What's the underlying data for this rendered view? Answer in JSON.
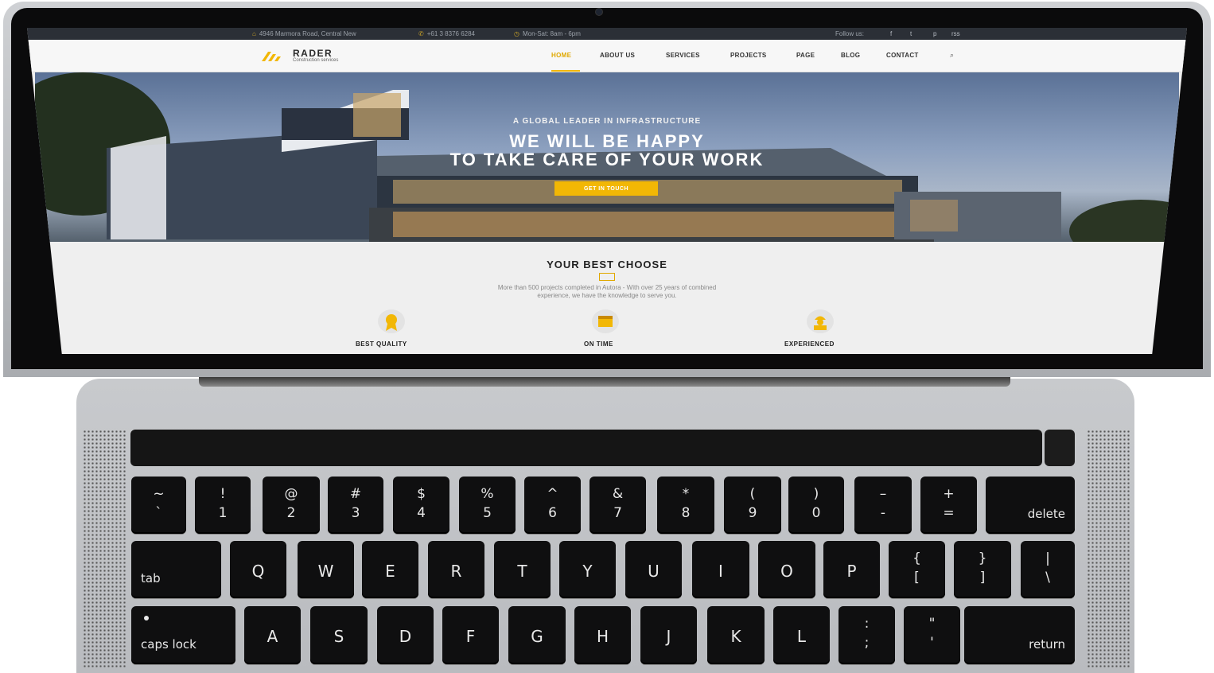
{
  "topbar": {
    "address": "4946 Marmora Road, Central New",
    "phone": "+61 3 8376 6284",
    "hours": "Mon-Sat: 8am - 6pm",
    "follow_label": "Follow us:",
    "social": [
      "f",
      "t",
      "p",
      "rss"
    ]
  },
  "brand": {
    "name": "RADER",
    "tagline": "Construction services",
    "accent": "#f2b705"
  },
  "nav": {
    "items": [
      "HOME",
      "ABOUT US",
      "SERVICES",
      "PROJECTS",
      "PAGE",
      "BLOG",
      "CONTACT"
    ],
    "active": "HOME",
    "search_icon": "search-icon"
  },
  "hero": {
    "subtitle": "A GLOBAL LEADER IN INFRASTRUCTURE",
    "line1": "WE WILL BE HAPPY",
    "line2": "TO TAKE CARE OF YOUR WORK",
    "cta": "GET IN TOUCH"
  },
  "section": {
    "title": "YOUR BEST CHOOSE",
    "desc_line1": "More than 500 projects completed in Autora - With over 25 years of combined",
    "desc_line2": "experience, we have the knowledge to serve you."
  },
  "features": [
    {
      "label": "BEST QUALITY",
      "icon": "award-icon"
    },
    {
      "label": "ON TIME",
      "icon": "calendar-icon"
    },
    {
      "label": "EXPERIENCED",
      "icon": "worker-icon"
    }
  ],
  "keyboard": {
    "row1": [
      {
        "top": "~",
        "bot": "`"
      },
      {
        "top": "!",
        "bot": "1"
      },
      {
        "top": "@",
        "bot": "2"
      },
      {
        "top": "#",
        "bot": "3"
      },
      {
        "top": "$",
        "bot": "4"
      },
      {
        "top": "%",
        "bot": "5"
      },
      {
        "top": "^",
        "bot": "6"
      },
      {
        "top": "&",
        "bot": "7"
      },
      {
        "top": "*",
        "bot": "8"
      },
      {
        "top": "(",
        "bot": "9"
      },
      {
        "top": ")",
        "bot": "0"
      },
      {
        "top": "–",
        "bot": "-"
      },
      {
        "top": "+",
        "bot": "="
      }
    ],
    "delete": "delete",
    "tab": "tab",
    "row2": [
      "Q",
      "W",
      "E",
      "R",
      "T",
      "Y",
      "U",
      "I",
      "O",
      "P"
    ],
    "row2_brackets": [
      {
        "top": "{",
        "bot": "["
      },
      {
        "top": "}",
        "bot": "]"
      },
      {
        "top": "|",
        "bot": "\\"
      }
    ],
    "caps": "caps lock",
    "row3": [
      "A",
      "S",
      "D",
      "F",
      "G",
      "H",
      "J",
      "K",
      "L"
    ],
    "row3_punct": [
      {
        "top": ":",
        "bot": ";"
      },
      {
        "top": "\"",
        "bot": "'"
      }
    ],
    "return": "return"
  }
}
